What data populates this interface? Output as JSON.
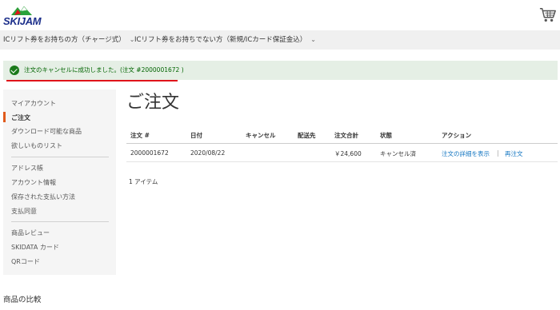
{
  "header": {
    "logo_text": "SKIJAM",
    "cart_icon": "cart-icon"
  },
  "nav": {
    "items": [
      {
        "label": "ICリフト券をお持ちの方（チャージ式）",
        "icon": "chevron-down-icon"
      },
      {
        "label": "ICリフト券をお持ちでない方（新規/ICカード保証金込）",
        "icon": "chevron-down-icon"
      }
    ]
  },
  "message": {
    "text": "注文のキャンセルに成功しました。(注文 #2000001672 )",
    "icon": "check-circle-icon",
    "color": "#006400",
    "background": "#e5efe5"
  },
  "sidebar": {
    "groups": [
      {
        "items": [
          {
            "label": "マイアカウント",
            "active": false
          },
          {
            "label": "ご注文",
            "active": true
          },
          {
            "label": "ダウンロード可能な商品",
            "active": false
          },
          {
            "label": "欲しいものリスト",
            "active": false
          }
        ]
      },
      {
        "items": [
          {
            "label": "アドレス帳",
            "active": false
          },
          {
            "label": "アカウント情報",
            "active": false
          },
          {
            "label": "保存された支払い方法",
            "active": false
          },
          {
            "label": "支払同意",
            "active": false
          }
        ]
      },
      {
        "items": [
          {
            "label": "商品レビュー",
            "active": false
          },
          {
            "label": "SKIDATA カード",
            "active": false
          },
          {
            "label": "QRコード",
            "active": false
          }
        ]
      }
    ]
  },
  "main": {
    "title": "ご注文",
    "table": {
      "headers": [
        "注文 #",
        "日付",
        "キャンセル",
        "配送先",
        "注文合計",
        "状態",
        "アクション"
      ],
      "rows": [
        {
          "order_no": "2000001672",
          "date": "2020/08/22",
          "cancel": "",
          "ship_to": "",
          "total": "￥24,600",
          "status": "キャンセル済",
          "actions": [
            "注文の詳細を表示",
            "再注文"
          ],
          "separator": "|"
        }
      ]
    },
    "items_count": "1 アイテム"
  },
  "compare": {
    "title": "商品の比較"
  },
  "colors": {
    "accent": "#e05a1c",
    "link": "#1979c3",
    "underline": "#e0141a"
  }
}
